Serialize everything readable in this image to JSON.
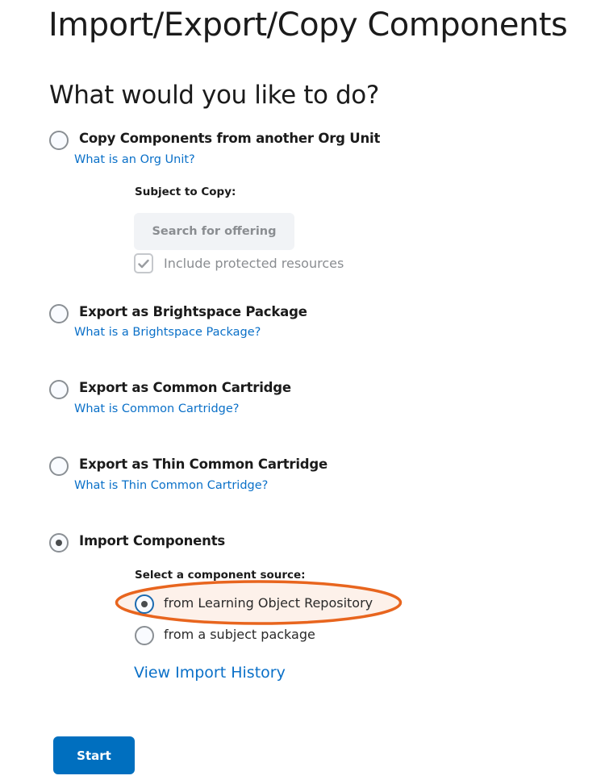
{
  "page": {
    "title": "Import/Export/Copy Components",
    "question": "What would you like to do?"
  },
  "options": [
    {
      "label": "Copy Components from another Org Unit",
      "help_link": "What is an Org Unit?",
      "selected": false
    },
    {
      "label": "Export as Brightspace Package",
      "help_link": "What is a Brightspace Package?",
      "selected": false
    },
    {
      "label": "Export as Common Cartridge",
      "help_link": "What is Common Cartridge?",
      "selected": false
    },
    {
      "label": "Export as Thin Common Cartridge",
      "help_link": "What is Thin Common Cartridge?",
      "selected": false
    },
    {
      "label": "Import Components",
      "selected": true
    }
  ],
  "copy_section": {
    "subject_label": "Subject to Copy:",
    "search_button": "Search for offering",
    "include_protected_label": "Include protected resources",
    "include_protected_checked": true
  },
  "import_section": {
    "source_label": "Select a component source:",
    "sources": [
      {
        "label": "from Learning Object Repository",
        "selected": true,
        "highlighted": true
      },
      {
        "label": "from a subject package",
        "selected": false
      }
    ],
    "view_history_link": "View Import History"
  },
  "actions": {
    "start_label": "Start"
  },
  "colors": {
    "link": "#0a70c8",
    "primary_button": "#006fbf",
    "annotation": "#e8651e"
  }
}
